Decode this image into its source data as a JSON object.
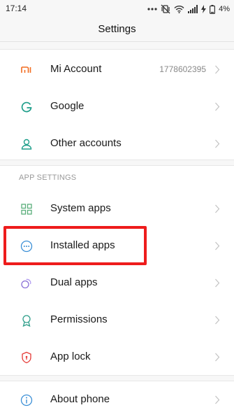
{
  "status_bar": {
    "time": "17:14",
    "battery_percent": "4%",
    "icons": [
      "more-dots-icon",
      "vibrate-off-icon",
      "wifi-icon",
      "signal-icon",
      "charging-bolt-icon",
      "battery-icon"
    ]
  },
  "header": {
    "title": "Settings"
  },
  "accounts": {
    "items": [
      {
        "label": "Mi Account",
        "value": "1778602395",
        "icon": "mi-logo-icon",
        "color": "#f26d21"
      },
      {
        "label": "Google",
        "icon": "google-g-icon",
        "color": "#1e9e8a"
      },
      {
        "label": "Other accounts",
        "icon": "person-icon",
        "color": "#1e9e8a"
      }
    ]
  },
  "app_settings": {
    "header": "APP SETTINGS",
    "items": [
      {
        "label": "System apps",
        "icon": "grid-icon",
        "color": "#5aae7b"
      },
      {
        "label": "Installed apps",
        "icon": "more-circle-icon",
        "color": "#3b8fd6"
      },
      {
        "label": "Dual apps",
        "icon": "dual-circles-icon",
        "color": "#8a6fd6"
      },
      {
        "label": "Permissions",
        "icon": "badge-icon",
        "color": "#2e9e8a"
      },
      {
        "label": "App lock",
        "icon": "shield-lock-icon",
        "color": "#e53935"
      }
    ]
  },
  "device": {
    "items": [
      {
        "label": "About phone",
        "icon": "info-icon",
        "color": "#3b8fd6"
      }
    ]
  },
  "highlight_color": "#ee1c1c"
}
